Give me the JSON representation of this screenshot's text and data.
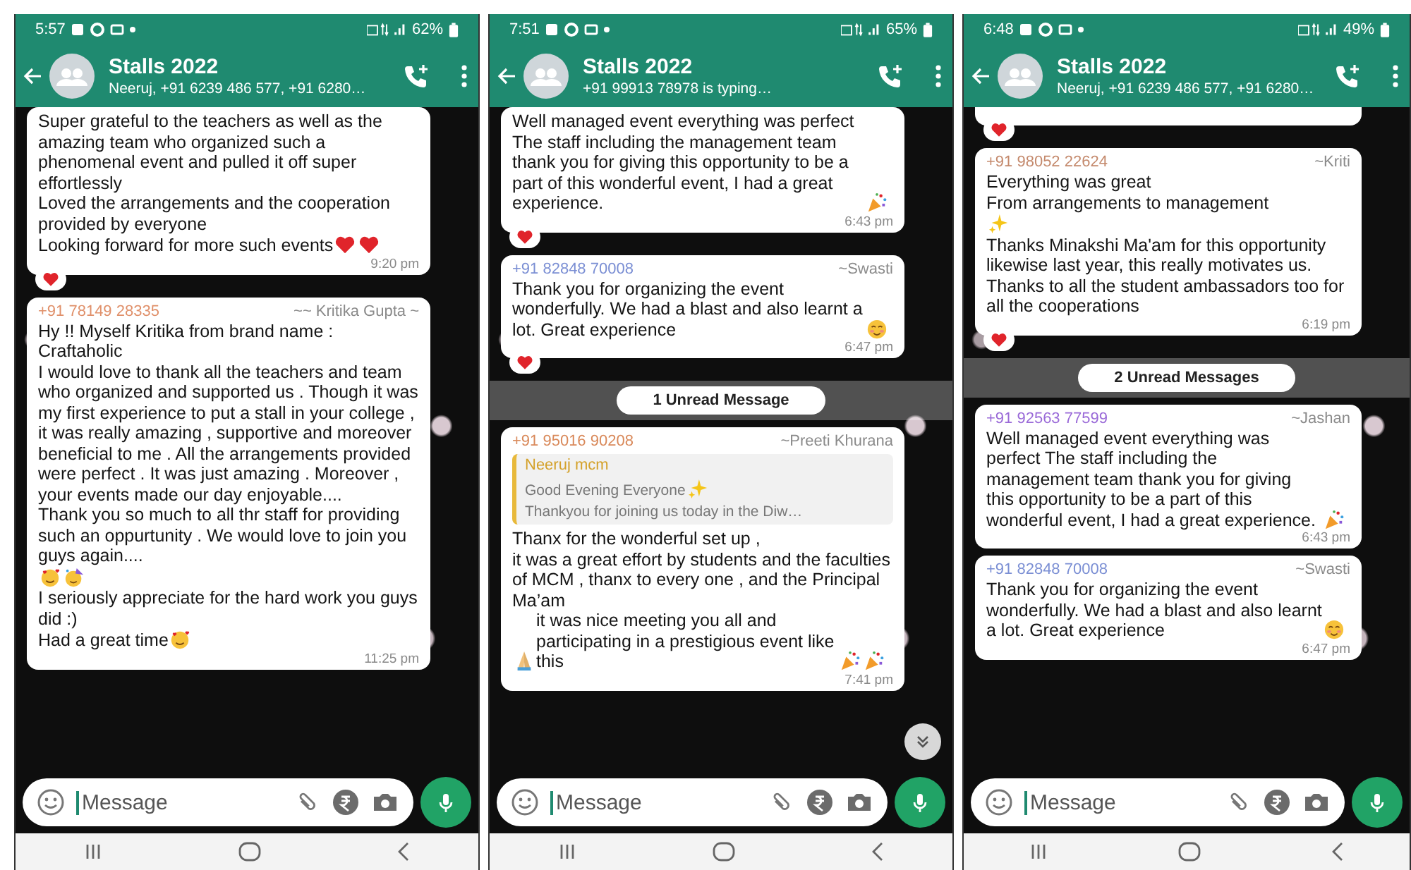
{
  "phones": [
    {
      "status_time": "5:57",
      "battery": "62%",
      "title": "Stalls 2022",
      "subtitle": "Neeruj, +91 6239 486 577, +91 6280…",
      "placeholder": "Message",
      "show_scroll_button": false,
      "items": [
        {
          "kind": "message",
          "paragraphs": [
            [
              {
                "kind": "text",
                "text": "Super grateful to the teachers as well as the amazing team who organized such a phenomenal event and pulled it off super effortlessly"
              }
            ],
            [
              {
                "kind": "text",
                "text": "Loved the arrangements and the cooperation provided by everyone"
              }
            ],
            [
              {
                "kind": "text",
                "text": "Looking forward for more such events"
              },
              {
                "kind": "heart"
              },
              {
                "kind": "heart"
              }
            ]
          ],
          "time": "9:20 pm",
          "heart_reaction": true
        },
        {
          "kind": "message",
          "sender_number": "+91 78149 28335",
          "sender_name": "~~ Kritika Gupta ~",
          "color": "#e0906a",
          "paragraphs": [
            [
              {
                "kind": "text",
                "text": "Hy !! Myself Kritika from brand name : Craftaholic"
              }
            ],
            [
              {
                "kind": "text",
                "text": "I would love to thank all the teachers and team who organized and supported us . Though it was my first experience to put a stall in your college , it was really amazing , supportive and moreover beneficial to me . All the arrangements provided were perfect . It was just amazing . Moreover , your events made our day enjoyable...."
              }
            ],
            [
              {
                "kind": "text",
                "text": "Thank you so much to all thr staff for providing such an oppurtunity . We would love to join you guys again...."
              }
            ],
            [
              {
                "kind": "smiling-hearts"
              },
              {
                "kind": "party-face"
              }
            ],
            [
              {
                "kind": "text",
                "text": "I seriously appreciate for the hard work you guys did :)"
              }
            ],
            [
              {
                "kind": "text",
                "text": "Had a great time"
              },
              {
                "kind": "smiling-hearts"
              }
            ]
          ],
          "time": "11:25 pm",
          "heart_reaction": false
        }
      ]
    },
    {
      "status_time": "7:51",
      "battery": "65%",
      "title": "Stalls 2022",
      "subtitle": "+91 99913 78978 is typing…",
      "placeholder": "Message",
      "show_scroll_button": true,
      "items": [
        {
          "kind": "message",
          "paragraphs": [
            [
              {
                "kind": "text",
                "text": "Well managed event everything was perfect The staff including the management team thank you for giving this opportunity to be a part of this wonderful event, I had a great experience."
              },
              {
                "kind": "party-popper"
              }
            ]
          ],
          "time": "6:43 pm",
          "heart_reaction": true
        },
        {
          "kind": "message",
          "sender_number": "+91 82848 70008",
          "sender_name": "~Swasti",
          "color": "#7b8fd4",
          "paragraphs": [
            [
              {
                "kind": "text",
                "text": "Thank you for organizing the event wonderfully. We had a blast and also learnt a lot. Great experience"
              },
              {
                "kind": "smile"
              }
            ]
          ],
          "time": "6:47 pm",
          "heart_reaction": true
        },
        {
          "kind": "unread",
          "label": "1 Unread Message"
        },
        {
          "kind": "message",
          "sender_number": "+91 95016 90208",
          "sender_name": "~Preeti Khurana",
          "color": "#d9895a",
          "quote": {
            "author": "Neeruj mcm",
            "lines": [
              [
                {
                  "kind": "text",
                  "text": "Good Evening Everyone"
                },
                {
                  "kind": "sparkles"
                }
              ],
              [
                {
                  "kind": "text",
                  "text": "Thankyou for joining us today in the Diw…"
                }
              ]
            ]
          },
          "paragraphs": [
            [
              {
                "kind": "text",
                "text": "Thanx for the wonderful set up ,"
              }
            ],
            [
              {
                "kind": "text",
                "text": "it was a great effort by students and the faculties of MCM , thanx to every one , and the Principal Ma’am"
              }
            ],
            [
              {
                "kind": "folded-hands"
              },
              {
                "kind": "text",
                "text": "it was nice meeting you all and participating in a prestigious event like this"
              },
              {
                "kind": "party-popper"
              },
              {
                "kind": "party-popper"
              }
            ]
          ],
          "time": "7:41 pm",
          "heart_reaction": false
        }
      ]
    },
    {
      "status_time": "6:48",
      "battery": "49%",
      "title": "Stalls 2022",
      "subtitle": "Neeruj, +91 6239 486 577, +91 6280…",
      "placeholder": "Message",
      "show_scroll_button": false,
      "items": [
        {
          "kind": "stub",
          "heart_reaction": true
        },
        {
          "kind": "message",
          "sender_number": "+91 98052 22624",
          "sender_name": "~Kriti",
          "color": "#c4896c",
          "paragraphs": [
            [
              {
                "kind": "text",
                "text": "Everything was great"
              }
            ],
            [
              {
                "kind": "text",
                "text": "From arrangements to management"
              }
            ],
            [
              {
                "kind": "sparkles"
              }
            ],
            [
              {
                "kind": "text",
                "text": "Thanks Minakshi Ma'am for this opportunity likewise last year, this really motivates us."
              }
            ],
            [
              {
                "kind": "text",
                "text": "Thanks to all the student ambassadors too for all the cooperations"
              }
            ]
          ],
          "time": "6:19 pm",
          "heart_reaction": true
        },
        {
          "kind": "unread",
          "label": "2 Unread Messages"
        },
        {
          "kind": "message",
          "sender_number": "+91 92563 77599",
          "sender_name": "~Jashan",
          "color": "#9a6ad8",
          "paragraphs": [
            [
              {
                "kind": "text",
                "text": "Well managed event everything was perfect The staff including the management team thank you for giving this opportunity to be a part of this wonderful event, I had a great experience."
              },
              {
                "kind": "party-popper"
              }
            ]
          ],
          "time": "6:43 pm",
          "heart_reaction": false
        },
        {
          "kind": "message",
          "sender_number": "+91 82848 70008",
          "sender_name": "~Swasti",
          "color": "#7b8fd4",
          "paragraphs": [
            [
              {
                "kind": "text",
                "text": "Thank you for organizing the event wonderfully. We had a blast and also learnt a lot. Great experience"
              },
              {
                "kind": "smile"
              }
            ]
          ],
          "time": "6:47 pm",
          "heart_reaction": false
        }
      ]
    }
  ]
}
